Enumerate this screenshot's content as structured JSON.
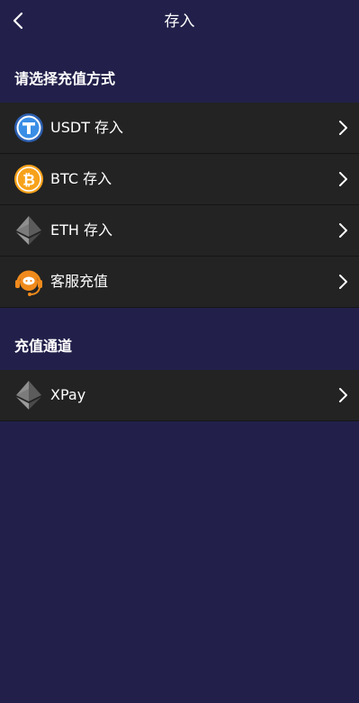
{
  "header": {
    "title": "存入",
    "back_icon": "chevron-left-icon"
  },
  "methods_section": {
    "title": "请选择充值方式",
    "items": [
      {
        "label": "USDT 存入",
        "icon": "usdt-tether-icon",
        "icon_color": "#3a7bd5"
      },
      {
        "label": "BTC 存入",
        "icon": "bitcoin-icon",
        "icon_color": "#f7a21b"
      },
      {
        "label": "ETH 存入",
        "icon": "ethereum-icon",
        "icon_color": "#8a8a8a"
      },
      {
        "label": "客服充值",
        "icon": "customer-service-headset-icon",
        "icon_color": "#f08a1c"
      }
    ]
  },
  "channels_section": {
    "title": "充值通道",
    "items": [
      {
        "label": "XPay",
        "icon": "ethereum-icon",
        "icon_color": "#8a8a8a"
      }
    ]
  },
  "colors": {
    "background": "#22204a",
    "row_background": "#232323",
    "text": "#ffffff"
  }
}
